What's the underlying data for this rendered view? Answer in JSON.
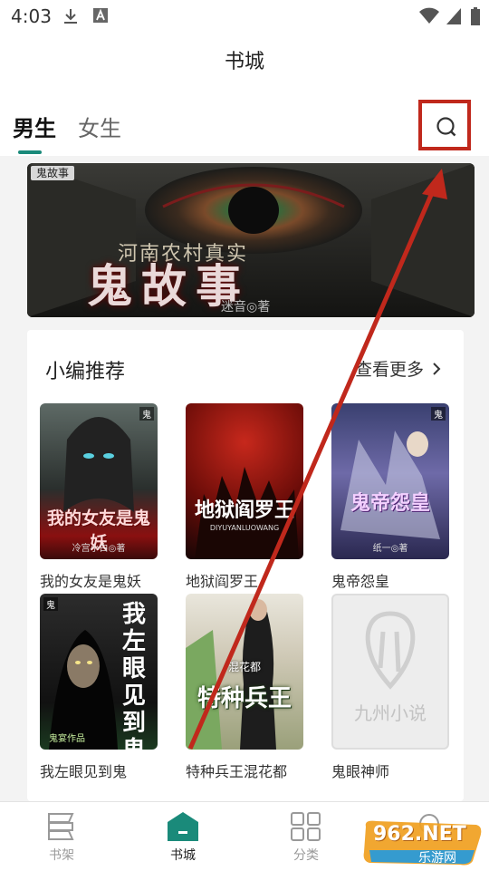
{
  "status_bar": {
    "time": "4:03"
  },
  "header": {
    "title": "书城"
  },
  "tabs": [
    {
      "label": "男生"
    },
    {
      "label": "女生"
    }
  ],
  "banner": {
    "brand": "鬼故事",
    "subtitle": "河南农村真实",
    "title": "鬼故事",
    "author": "迷音◎著"
  },
  "section": {
    "title": "小编推荐",
    "more_label": "查看更多"
  },
  "books": [
    {
      "title": "我的女友是鬼妖",
      "cover_text": "我的女友是鬼妖",
      "cover_author": "冷宫小白◎著"
    },
    {
      "title": "地狱阎罗王",
      "cover_text": "地狱阎罗王",
      "cover_author": "DIYUYANLUOWANG"
    },
    {
      "title": "鬼帝怨皇",
      "cover_text": "鬼帝怨皇",
      "cover_author": "纸一◎著"
    },
    {
      "title": "我左眼见到鬼",
      "cover_text": "我左眼见到鬼",
      "cover_author": "鬼宴作品"
    },
    {
      "title": "特种兵王混花都",
      "cover_text": "特种兵王",
      "cover_author": "混花都"
    },
    {
      "title": "鬼眼神师",
      "cover_text": "九州小说",
      "cover_author": ""
    }
  ],
  "nav": [
    {
      "label": "书架",
      "icon": "bookshelf-icon",
      "color": "#999999"
    },
    {
      "label": "书城",
      "icon": "bookstore-icon",
      "color": "#1a8a7a"
    },
    {
      "label": "分类",
      "icon": "category-grid-icon",
      "color": "#999999"
    }
  ],
  "watermark": {
    "text": "962.NET",
    "subtext": "乐游网"
  },
  "colors": {
    "accent": "#1a8a7a",
    "annotation": "#c0281c"
  }
}
